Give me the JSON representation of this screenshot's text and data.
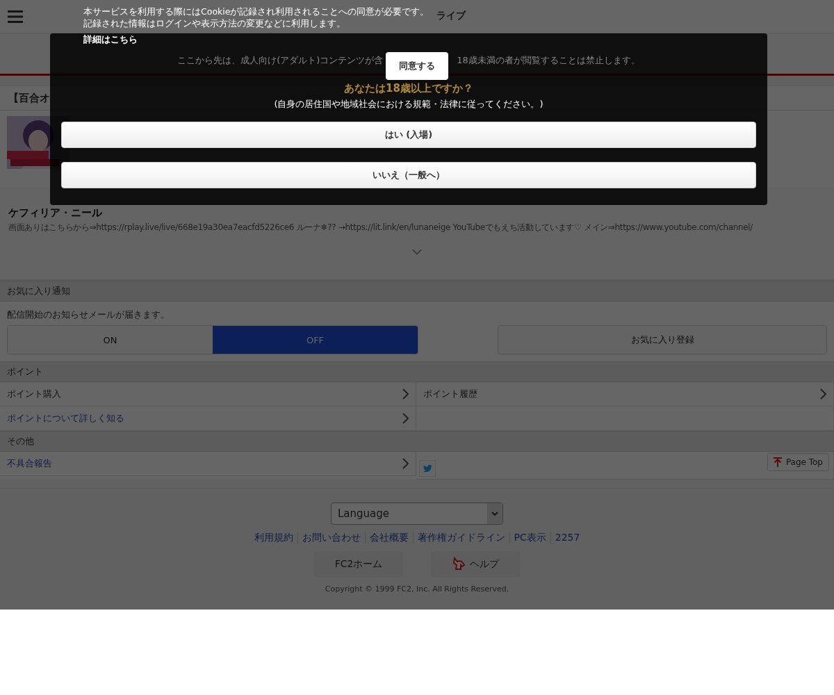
{
  "header": {
    "logo_text": "ライブ"
  },
  "stream": {
    "title": "【百合オ",
    "performer": "ケフィリア・ニール",
    "description": "画面ありはこちらから⇒https://rplay.live/live/668e19a30ea7eacfd5226ce6 ルーナ❄?? →https://lit.link/en/lunaneige YouTubeでもえち活動しています♡ メイン⇒https://www.youtube.com/channel/"
  },
  "favorites": {
    "heading": "お気に入り通知",
    "note": "配信開始のお知らせメールが届きます。",
    "toggle": [
      {
        "label": "ON",
        "selected": false
      },
      {
        "label": "OFF",
        "selected": true
      }
    ],
    "register_button": "お気に入り登録"
  },
  "points": {
    "heading": "ポイント",
    "items": [
      {
        "label": "ポイント購入",
        "kind": "muted"
      },
      {
        "label": "ポイント履歴",
        "kind": "muted"
      },
      {
        "label": "ポイントについて詳しく知る",
        "kind": "link"
      }
    ]
  },
  "other": {
    "heading": "その他",
    "items": [
      {
        "label": "不具合報告",
        "kind": "link"
      }
    ],
    "page_top": "Page Top"
  },
  "footer": {
    "language": "Language",
    "links": [
      "利用規約",
      "お問い合わせ",
      "会社概要",
      "著作権ガイドライン",
      "PC表示",
      "2257"
    ],
    "buttons": [
      {
        "label": "FC2ホーム",
        "kind": "plain"
      },
      {
        "label": "ヘルプ",
        "kind": "help"
      }
    ],
    "copyright": "Copyright © 1999 FC2, Inc. All Rights Reserved."
  },
  "cookie_notice": {
    "lines": [
      "本サービスを利用する際にはCookieが記録され利用されることへの同意が必要です。",
      "記録された情報はログインや表示方法の変更などに利用します。"
    ],
    "details_link": "詳細はこちら",
    "agree_button": "同意する"
  },
  "age_gate": {
    "notice_left": "ここから先は、成人向け(アダルト)コンテンツが含",
    "notice_right": "18歳未満の者が閲覧することは禁止します。",
    "question": "あなたは18歳以上ですか？",
    "hint": "(自身の居住国や地域社会における規範・法律に従ってください。)",
    "buttons": [
      {
        "label": "はい (入場)"
      },
      {
        "label": "いいえ（一般へ）"
      }
    ]
  }
}
